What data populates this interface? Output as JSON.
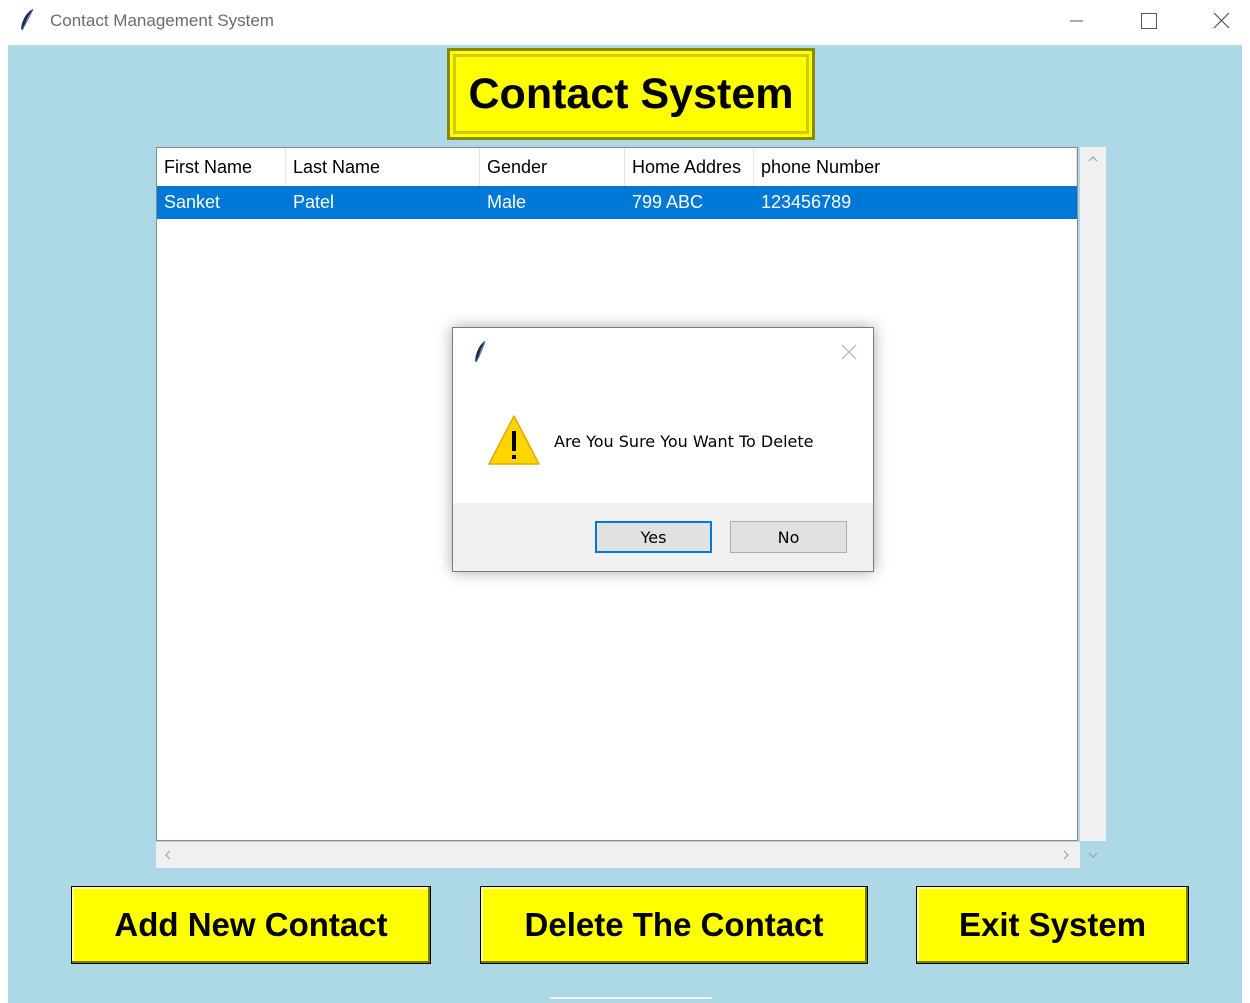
{
  "window": {
    "title": "Contact Management System"
  },
  "header": {
    "title": "Contact System"
  },
  "table": {
    "columns": [
      "First Name",
      "Last Name",
      "Gender",
      "Home Addres",
      "phone Number"
    ],
    "rows": [
      {
        "first_name": "Sanket",
        "last_name": "Patel",
        "gender": "Male",
        "home_address": "799 ABC",
        "phone": "123456789",
        "selected": true
      }
    ]
  },
  "buttons": {
    "add": "Add New Contact",
    "delete": "Delete The Contact",
    "exit": "Exit System"
  },
  "dialog": {
    "message": "Are You Sure You Want To Delete",
    "yes": "Yes",
    "no": "No"
  },
  "colors": {
    "background": "#add8e6",
    "button": "#ffff00",
    "selection": "#0078d7"
  }
}
